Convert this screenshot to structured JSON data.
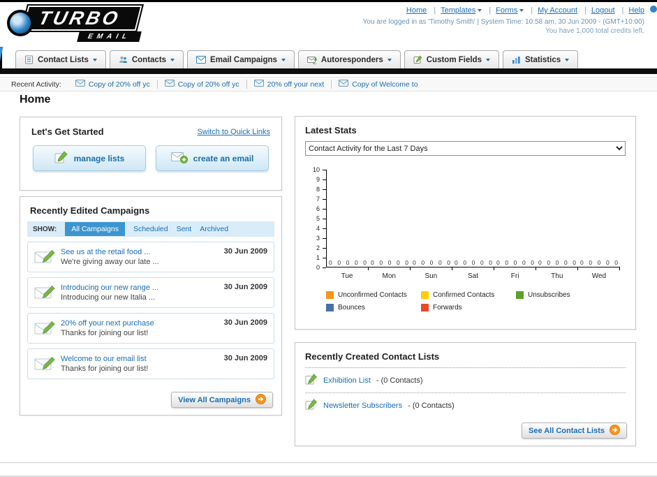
{
  "colors": {
    "link": "#1a6eb5",
    "nav_active": "#3d95cf",
    "accent_orange": "#f7941d"
  },
  "header": {
    "logo": {
      "top": "TURBO",
      "bottom": "EMAIL"
    },
    "links": [
      {
        "label": "Home",
        "dropdown": false
      },
      {
        "label": "Templates",
        "dropdown": true
      },
      {
        "label": "Forms",
        "dropdown": true
      },
      {
        "label": "My Account",
        "dropdown": false
      },
      {
        "label": "Logout",
        "dropdown": false
      },
      {
        "label": "Help",
        "dropdown": false
      }
    ],
    "session_line": "You are logged in as 'Timothy Smith' | System Time: 10:58 am, 30 Jun 2009 - (GMT+10:00)",
    "credits_line": "You have 1,000 total credits left."
  },
  "nav": {
    "tabs": [
      {
        "label": "Contact Lists"
      },
      {
        "label": "Contacts"
      },
      {
        "label": "Email Campaigns"
      },
      {
        "label": "Autoresponders"
      },
      {
        "label": "Custom Fields"
      },
      {
        "label": "Statistics"
      }
    ]
  },
  "recent_activity": {
    "label": "Recent Activity:",
    "items": [
      "Copy of 20% off yc",
      "Copy of 20% off yc",
      "20% off your next",
      "Copy of Welcome to"
    ]
  },
  "page_title": "Home",
  "get_started": {
    "title": "Let's Get Started",
    "switch_link": "Switch to Quick Links",
    "manage_lists_label": "manage lists",
    "create_email_label": "create an email"
  },
  "campaigns": {
    "title": "Recently Edited Campaigns",
    "show_label": "SHOW:",
    "filters": [
      "All Campaigns",
      "Scheduled",
      "Sent",
      "Archived"
    ],
    "active_filter": "All Campaigns",
    "items": [
      {
        "title": "See us at the retail food ...",
        "subtitle": "We're giving away our late ...",
        "date": "30 Jun 2009"
      },
      {
        "title": "Introducing our new range ...",
        "subtitle": "Introducing our new Italia ...",
        "date": "30 Jun 2009"
      },
      {
        "title": "20% off your next purchase",
        "subtitle": "Thanks for joining our list!",
        "date": "30 Jun 2009"
      },
      {
        "title": "Welcome to our email list",
        "subtitle": "Thanks for joining our list!",
        "date": "30 Jun 2009"
      }
    ],
    "view_all_label": "View All Campaigns"
  },
  "stats": {
    "title": "Latest Stats",
    "dropdown_value": "Contact Activity for the Last 7 Days",
    "chart_data": {
      "type": "bar",
      "categories": [
        "Tue",
        "Mon",
        "Sun",
        "Sat",
        "Fri",
        "Thu",
        "Wed"
      ],
      "series": [
        {
          "name": "Unconfirmed Contacts",
          "values": [
            0,
            0,
            0,
            0,
            0,
            0,
            0
          ]
        },
        {
          "name": "Confirmed Contacts",
          "values": [
            0,
            0,
            0,
            0,
            0,
            0,
            0
          ]
        },
        {
          "name": "Unsubscribes",
          "values": [
            0,
            0,
            0,
            0,
            0,
            0,
            0
          ]
        },
        {
          "name": "Bounces",
          "values": [
            0,
            0,
            0,
            0,
            0,
            0,
            0
          ]
        },
        {
          "name": "Forwards",
          "values": [
            0,
            0,
            0,
            0,
            0,
            0,
            0
          ]
        }
      ],
      "ylim": [
        0,
        10
      ],
      "yticks": [
        0,
        1,
        2,
        3,
        4,
        5,
        6,
        7,
        8,
        9,
        10
      ],
      "grid": false,
      "legend_position": "bottom"
    },
    "legend": [
      {
        "label": "Unconfirmed Contacts",
        "color": "#f7941d"
      },
      {
        "label": "Confirmed Contacts",
        "color": "#ffcc00"
      },
      {
        "label": "Unsubscribes",
        "color": "#5ca028"
      },
      {
        "label": "Bounces",
        "color": "#4a6fa5"
      },
      {
        "label": "Forwards",
        "color": "#e8492a"
      }
    ]
  },
  "contact_lists": {
    "title": "Recently Created Contact Lists",
    "items": [
      {
        "name": "Exhibition List",
        "detail": "- (0 Contacts)"
      },
      {
        "name": "Newsletter Subscribers",
        "detail": "- (0 Contacts)"
      }
    ],
    "see_all_label": "See All Contact Lists"
  }
}
